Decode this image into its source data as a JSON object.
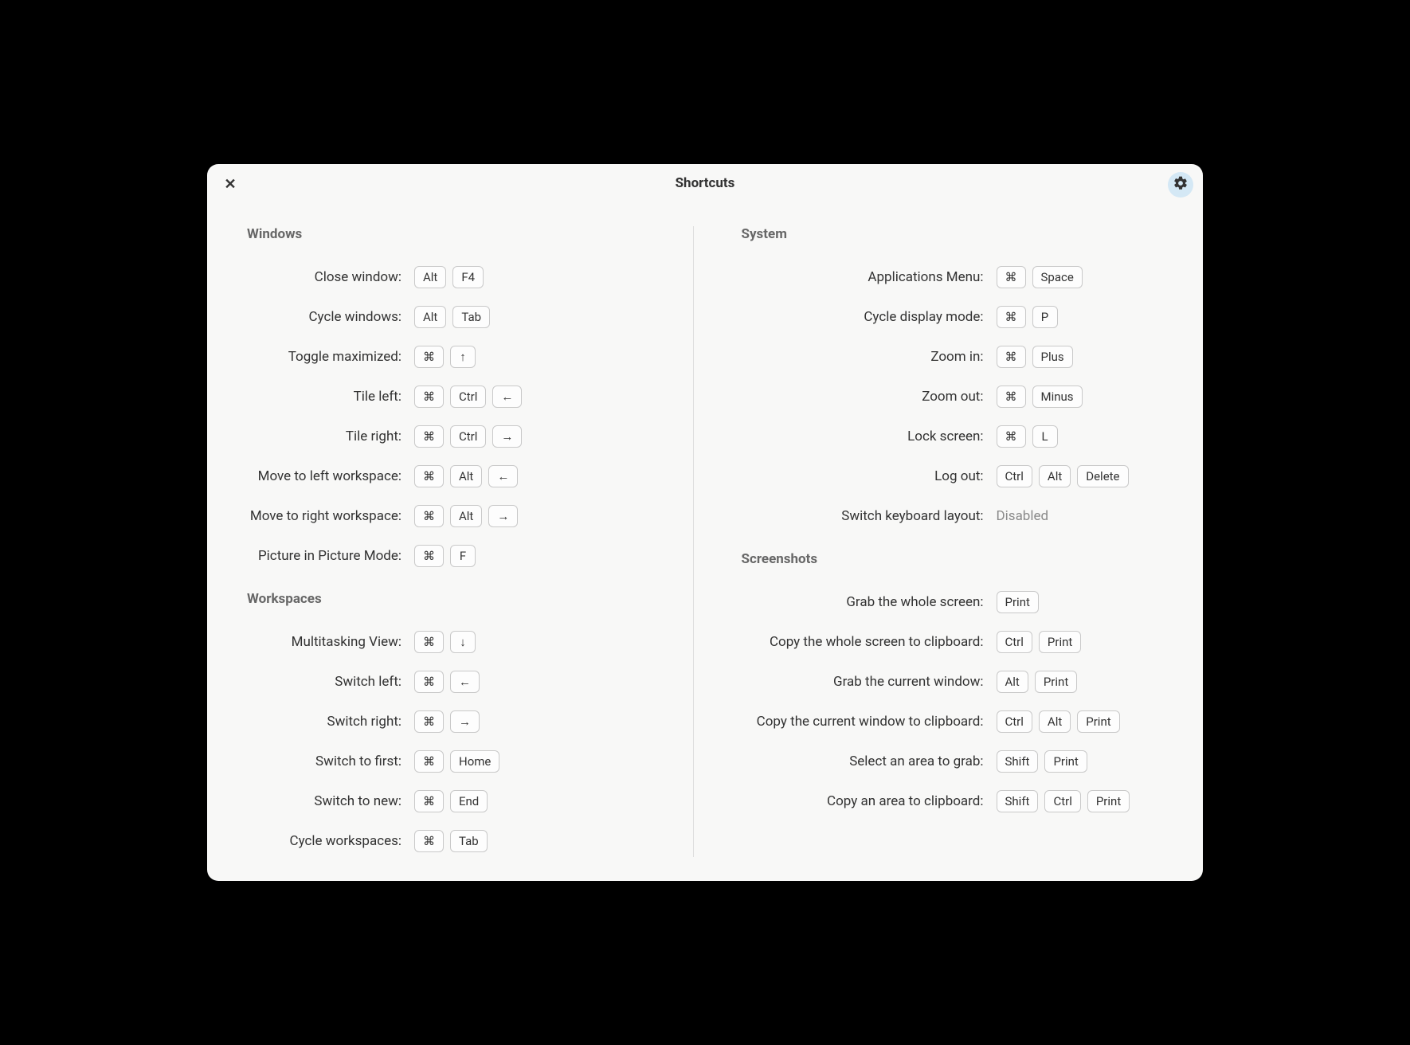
{
  "title": "Shortcuts",
  "left": {
    "sections": [
      {
        "title": "Windows",
        "rows": [
          {
            "label": "Close window:",
            "keys": [
              "Alt",
              "F4"
            ]
          },
          {
            "label": "Cycle windows:",
            "keys": [
              "Alt",
              "Tab"
            ]
          },
          {
            "label": "Toggle maximized:",
            "keys": [
              "⌘",
              "↑"
            ]
          },
          {
            "label": "Tile left:",
            "keys": [
              "⌘",
              "Ctrl",
              "←"
            ]
          },
          {
            "label": "Tile right:",
            "keys": [
              "⌘",
              "Ctrl",
              "→"
            ]
          },
          {
            "label": "Move to left workspace:",
            "keys": [
              "⌘",
              "Alt",
              "←"
            ]
          },
          {
            "label": "Move to right workspace:",
            "keys": [
              "⌘",
              "Alt",
              "→"
            ]
          },
          {
            "label": "Picture in Picture Mode:",
            "keys": [
              "⌘",
              "F"
            ]
          }
        ]
      },
      {
        "title": "Workspaces",
        "rows": [
          {
            "label": "Multitasking View:",
            "keys": [
              "⌘",
              "↓"
            ]
          },
          {
            "label": "Switch left:",
            "keys": [
              "⌘",
              "←"
            ]
          },
          {
            "label": "Switch right:",
            "keys": [
              "⌘",
              "→"
            ]
          },
          {
            "label": "Switch to first:",
            "keys": [
              "⌘",
              "Home"
            ]
          },
          {
            "label": "Switch to new:",
            "keys": [
              "⌘",
              "End"
            ]
          },
          {
            "label": "Cycle workspaces:",
            "keys": [
              "⌘",
              "Tab"
            ]
          }
        ]
      }
    ]
  },
  "right": {
    "sections": [
      {
        "title": "System",
        "rows": [
          {
            "label": "Applications Menu:",
            "keys": [
              "⌘",
              "Space"
            ]
          },
          {
            "label": "Cycle display mode:",
            "keys": [
              "⌘",
              "P"
            ]
          },
          {
            "label": "Zoom in:",
            "keys": [
              "⌘",
              "Plus"
            ]
          },
          {
            "label": "Zoom out:",
            "keys": [
              "⌘",
              "Minus"
            ]
          },
          {
            "label": "Lock screen:",
            "keys": [
              "⌘",
              "L"
            ]
          },
          {
            "label": "Log out:",
            "keys": [
              "Ctrl",
              "Alt",
              "Delete"
            ]
          },
          {
            "label": "Switch keyboard layout:",
            "disabled": "Disabled"
          }
        ]
      },
      {
        "title": "Screenshots",
        "rows": [
          {
            "label": "Grab the whole screen:",
            "keys": [
              "Print"
            ]
          },
          {
            "label": "Copy the whole screen to clipboard:",
            "keys": [
              "Ctrl",
              "Print"
            ]
          },
          {
            "label": "Grab the current window:",
            "keys": [
              "Alt",
              "Print"
            ]
          },
          {
            "label": "Copy the current window to clipboard:",
            "keys": [
              "Ctrl",
              "Alt",
              "Print"
            ]
          },
          {
            "label": "Select an area to grab:",
            "keys": [
              "Shift",
              "Print"
            ]
          },
          {
            "label": "Copy an area to clipboard:",
            "keys": [
              "Shift",
              "Ctrl",
              "Print"
            ]
          }
        ]
      }
    ]
  }
}
